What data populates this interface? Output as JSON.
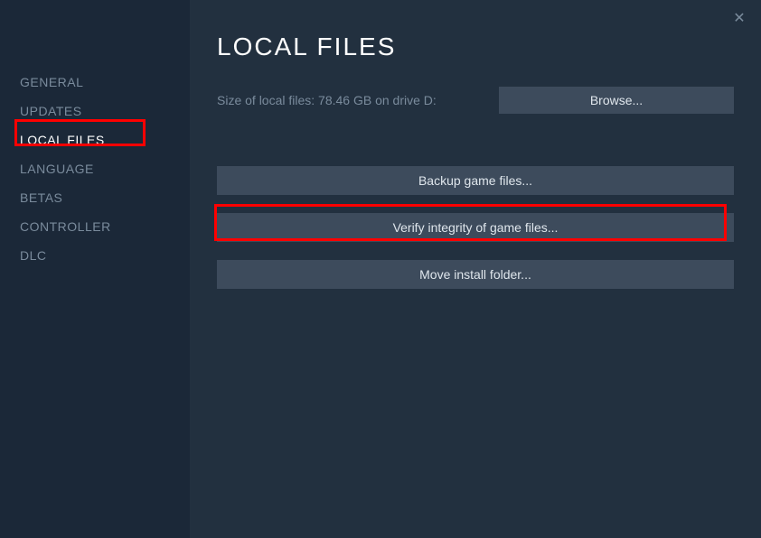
{
  "sidebar": {
    "items": [
      {
        "label": "GENERAL"
      },
      {
        "label": "UPDATES"
      },
      {
        "label": "LOCAL FILES"
      },
      {
        "label": "LANGUAGE"
      },
      {
        "label": "BETAS"
      },
      {
        "label": "CONTROLLER"
      },
      {
        "label": "DLC"
      }
    ]
  },
  "main": {
    "title": "LOCAL FILES",
    "sizeText": "Size of local files: 78.46 GB on drive D:",
    "browseLabel": "Browse...",
    "backupLabel": "Backup game files...",
    "verifyLabel": "Verify integrity of game files...",
    "moveLabel": "Move install folder..."
  }
}
